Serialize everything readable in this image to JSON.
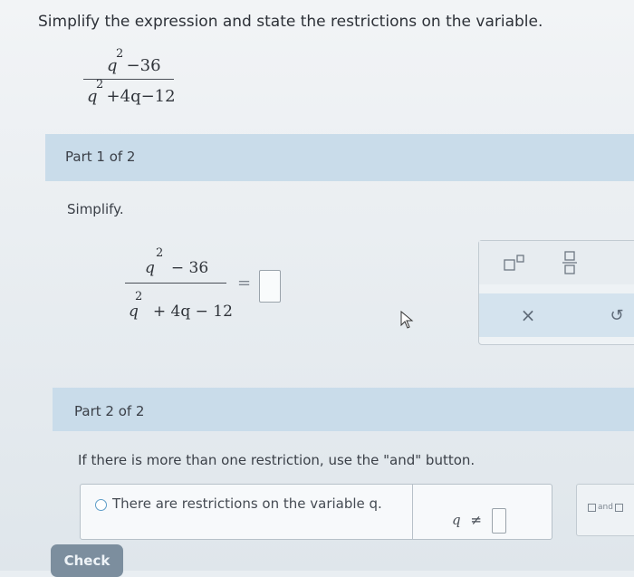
{
  "prompt": "Simplify the expression and state the restrictions on the variable.",
  "expression": {
    "numerator": {
      "var": "q",
      "exp": "2",
      "rest": "−36"
    },
    "denominator": {
      "var": "q",
      "exp": "2",
      "rest": "+4q−12"
    }
  },
  "part1": {
    "title": "Part 1 of 2",
    "instruction": "Simplify.",
    "numerator": {
      "var": "q",
      "exp": "2",
      "rest": "− 36"
    },
    "denominator": {
      "var": "q",
      "exp": "2",
      "rest": "+ 4q − 12"
    },
    "equals": "="
  },
  "palette": {
    "clear": "×",
    "undo": "↺"
  },
  "part2": {
    "title": "Part 2 of 2",
    "instruction": "If there is more than one restriction, use the \"and\" button.",
    "option_label": "There are restrictions on the variable q.",
    "neq_var": "q",
    "neq_symbol": "≠",
    "and_label": "and"
  },
  "check_label": "Check"
}
